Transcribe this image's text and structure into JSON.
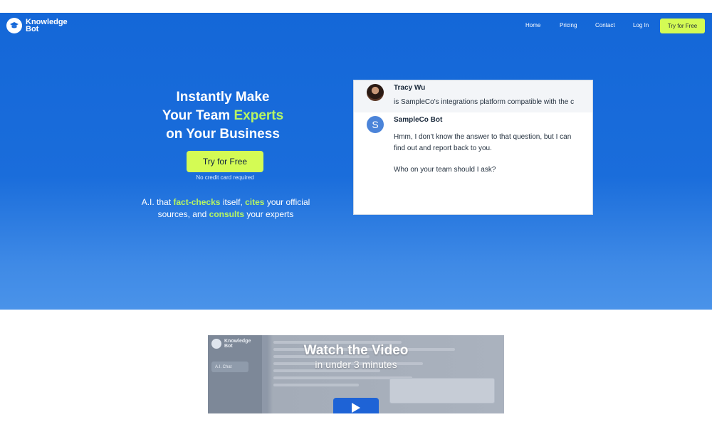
{
  "nav": {
    "logo_line1": "Knowledge",
    "logo_line2": "Bot",
    "links": [
      "Home",
      "Pricing",
      "Contact",
      "Log In"
    ],
    "cta": "Try for Free"
  },
  "hero": {
    "headline_line1": "Instantly Make",
    "headline_line2_pre": "Your Team ",
    "headline_line2_hl": "Experts",
    "headline_line3": "on Your Business",
    "button": "Try for Free",
    "no_cc": "No credit card required",
    "tagline": {
      "p1": "A.I. that ",
      "h1": "fact-checks",
      "p2": " itself, ",
      "h2": "cites",
      "p3": " your official sources, and ",
      "h3": "consults",
      "p4": " your experts"
    }
  },
  "chat": {
    "messages": [
      {
        "sender": "Tracy Wu",
        "avatar": "user-photo",
        "lines": [
          "is SampleCo's integrations platform compatible with the c"
        ]
      },
      {
        "sender": "SampleCo Bot",
        "avatar_letter": "S",
        "lines": [
          "Hmm, I don't know the answer to that question, but I can",
          "find out and report back to you.",
          "",
          "Who on your team should I ask?"
        ]
      }
    ]
  },
  "video": {
    "title": "Watch the Video",
    "subtitle": "in under 3 minutes",
    "thumb_logo_line1": "Knowledge",
    "thumb_logo_line2": "Bot",
    "thumb_tab": "A.I. Chat"
  },
  "colors": {
    "brand_blue": "#1467d8",
    "accent_lime": "#d4fb54",
    "highlight_green": "#b6f563"
  }
}
